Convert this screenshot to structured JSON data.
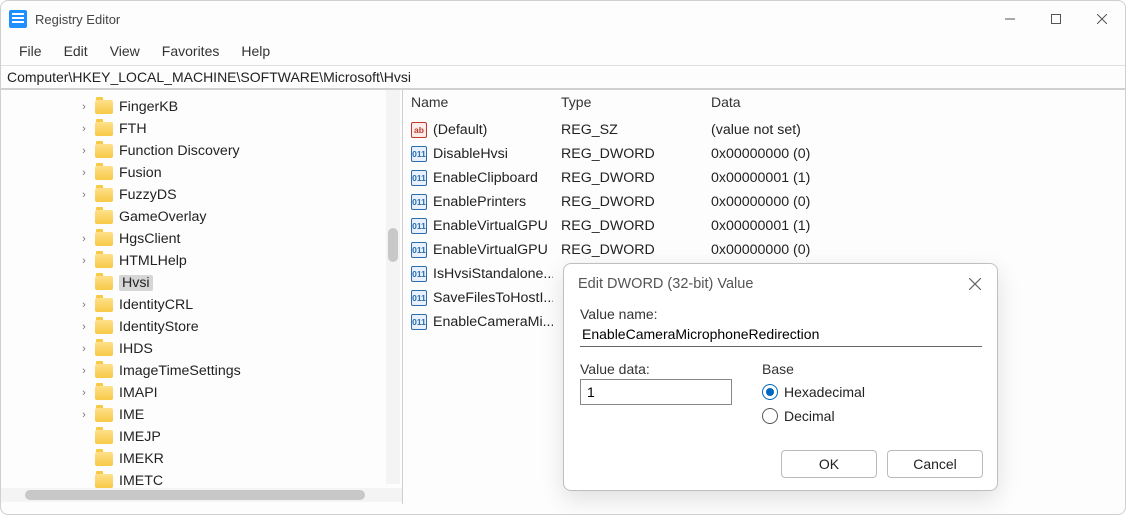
{
  "window": {
    "title": "Registry Editor"
  },
  "menu": {
    "file": "File",
    "edit": "Edit",
    "view": "View",
    "favorites": "Favorites",
    "help": "Help"
  },
  "address": "Computer\\HKEY_LOCAL_MACHINE\\SOFTWARE\\Microsoft\\Hvsi",
  "tree": [
    {
      "label": "FingerKB",
      "exp": true,
      "indent": 2
    },
    {
      "label": "FTH",
      "exp": true,
      "indent": 2
    },
    {
      "label": "Function Discovery",
      "exp": true,
      "indent": 2
    },
    {
      "label": "Fusion",
      "exp": true,
      "indent": 2
    },
    {
      "label": "FuzzyDS",
      "exp": true,
      "indent": 2
    },
    {
      "label": "GameOverlay",
      "exp": false,
      "indent": 2
    },
    {
      "label": "HgsClient",
      "exp": true,
      "indent": 2
    },
    {
      "label": "HTMLHelp",
      "exp": true,
      "indent": 2
    },
    {
      "label": "Hvsi",
      "exp": false,
      "indent": 2,
      "selected": true
    },
    {
      "label": "IdentityCRL",
      "exp": true,
      "indent": 2
    },
    {
      "label": "IdentityStore",
      "exp": true,
      "indent": 2
    },
    {
      "label": "IHDS",
      "exp": true,
      "indent": 2
    },
    {
      "label": "ImageTimeSettings",
      "exp": true,
      "indent": 2
    },
    {
      "label": "IMAPI",
      "exp": true,
      "indent": 2
    },
    {
      "label": "IME",
      "exp": true,
      "indent": 2
    },
    {
      "label": "IMEJP",
      "exp": false,
      "indent": 2
    },
    {
      "label": "IMEKR",
      "exp": false,
      "indent": 2
    },
    {
      "label": "IMETC",
      "exp": false,
      "indent": 2
    }
  ],
  "columns": {
    "name": "Name",
    "type": "Type",
    "data": "Data"
  },
  "values": [
    {
      "icon": "sz",
      "name": "(Default)",
      "type": "REG_SZ",
      "data": "(value not set)"
    },
    {
      "icon": "dw",
      "name": "DisableHvsi",
      "type": "REG_DWORD",
      "data": "0x00000000 (0)"
    },
    {
      "icon": "dw",
      "name": "EnableClipboard",
      "type": "REG_DWORD",
      "data": "0x00000001 (1)"
    },
    {
      "icon": "dw",
      "name": "EnablePrinters",
      "type": "REG_DWORD",
      "data": "0x00000000 (0)"
    },
    {
      "icon": "dw",
      "name": "EnableVirtualGPU",
      "type": "REG_DWORD",
      "data": "0x00000001 (1)"
    },
    {
      "icon": "dw",
      "name": "EnableVirtualGPU",
      "type": "REG_DWORD",
      "data": "0x00000000 (0)"
    },
    {
      "icon": "dw",
      "name": "IsHvsiStandalone...",
      "type": "",
      "data": ""
    },
    {
      "icon": "dw",
      "name": "SaveFilesToHostI...",
      "type": "",
      "data": ""
    },
    {
      "icon": "dw",
      "name": "EnableCameraMi...",
      "type": "",
      "data": ""
    }
  ],
  "dialog": {
    "title": "Edit DWORD (32-bit) Value",
    "value_name_label": "Value name:",
    "value_name": "EnableCameraMicrophoneRedirection",
    "value_data_label": "Value data:",
    "value_data": "1",
    "base_label": "Base",
    "hex": "Hexadecimal",
    "dec": "Decimal",
    "ok": "OK",
    "cancel": "Cancel"
  }
}
